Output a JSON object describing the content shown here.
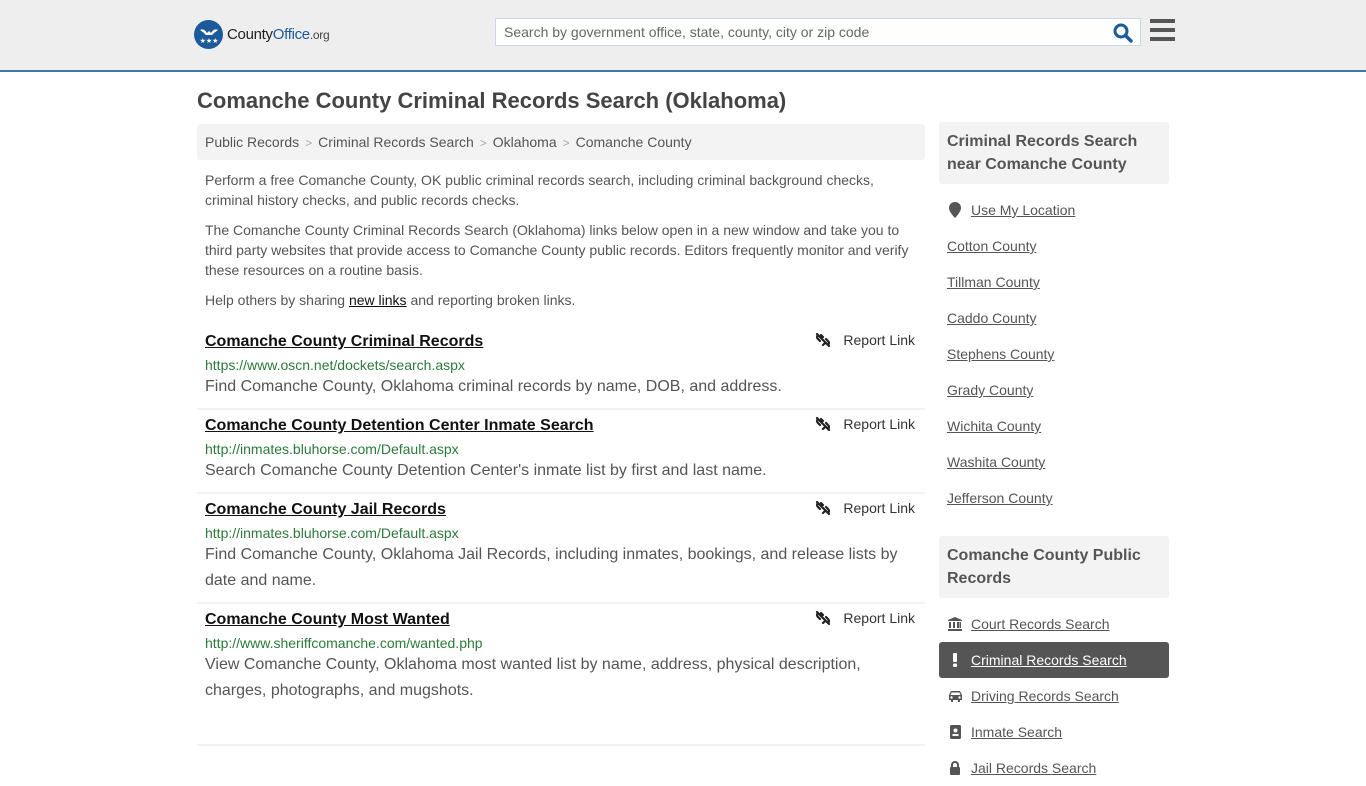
{
  "header": {
    "logo": {
      "name": "County",
      "office": "Office",
      "tld": ".org"
    },
    "search": {
      "placeholder": "Search by government office, state, county, city or zip code",
      "value": ""
    },
    "icons": {
      "search": "search-icon",
      "menu": "hamburger-menu-icon"
    }
  },
  "page": {
    "title": "Comanche County Criminal Records Search (Oklahoma)",
    "breadcrumb": [
      "Public Records",
      "Criminal Records Search",
      "Oklahoma",
      "Comanche County"
    ],
    "breadcrumb_separator": ">",
    "intro": {
      "p1": "Perform a free Comanche County, OK public criminal records search, including criminal background checks, criminal history checks, and public records checks.",
      "p2": "The Comanche County Criminal Records Search (Oklahoma) links below open in a new window and take you to third party websites that provide access to Comanche County public records. Editors frequently monitor and verify these resources on a routine basis.",
      "p3_before": "Help others by sharing ",
      "p3_link": "new links",
      "p3_after": " and reporting broken links."
    }
  },
  "results": [
    {
      "title": "Comanche County Criminal Records",
      "url": "https://www.oscn.net/dockets/search.aspx",
      "description": "Find Comanche County, Oklahoma criminal records by name, DOB, and address.",
      "report_label": "Report Link"
    },
    {
      "title": "Comanche County Detention Center Inmate Search",
      "url": "http://inmates.bluhorse.com/Default.aspx",
      "description": "Search Comanche County Detention Center's inmate list by first and last name.",
      "report_label": "Report Link"
    },
    {
      "title": "Comanche County Jail Records",
      "url": "http://inmates.bluhorse.com/Default.aspx",
      "description": "Find Comanche County, Oklahoma Jail Records, including inmates, bookings, and release lists by date and name.",
      "report_label": "Report Link"
    },
    {
      "title": "Comanche County Most Wanted",
      "url": "http://www.sheriffcomanche.com/wanted.php",
      "description": "View Comanche County, Oklahoma most wanted list by name, address, physical description, charges, photographs, and mugshots.",
      "report_label": "Report Link"
    }
  ],
  "sidebar": {
    "nearby": {
      "heading": "Criminal Records Search near Comanche County",
      "use_location": "Use My Location",
      "counties": [
        "Cotton County",
        "Tillman County",
        "Caddo County",
        "Stephens County",
        "Grady County",
        "Wichita County",
        "Washita County",
        "Jefferson County"
      ]
    },
    "public_records": {
      "heading": "Comanche County Public Records",
      "items": [
        {
          "label": "Court Records Search",
          "icon": "courthouse-icon",
          "active": false
        },
        {
          "label": "Criminal Records Search",
          "icon": "exclamation-icon",
          "active": true
        },
        {
          "label": "Driving Records Search",
          "icon": "car-icon",
          "active": false
        },
        {
          "label": "Inmate Search",
          "icon": "id-badge-icon",
          "active": false
        },
        {
          "label": "Jail Records Search",
          "icon": "lock-icon",
          "active": false
        }
      ]
    }
  },
  "colors": {
    "brand_blue": "#1d5a9a",
    "header_border": "#3e78a8",
    "url_green": "#2b7a3a",
    "active_bg": "#555555"
  }
}
